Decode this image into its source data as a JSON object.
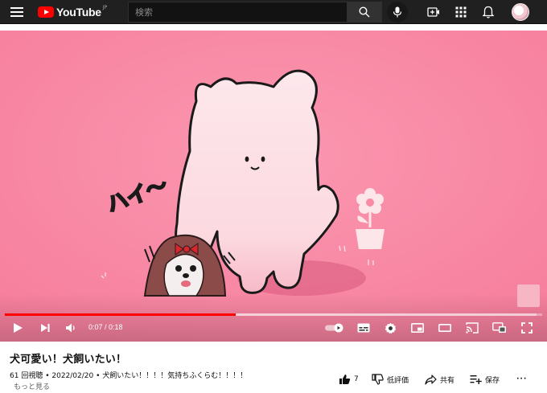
{
  "header": {
    "logo_text": "YouTube",
    "logo_region": "JP",
    "search_placeholder": "検索",
    "icons": [
      "menu-icon",
      "search-icon",
      "mic-icon",
      "create-icon",
      "apps-icon",
      "bell-icon"
    ]
  },
  "player": {
    "current_time": "0:07",
    "duration": "0:18",
    "progress_fraction": 0.43,
    "buffered_fraction": 0.99,
    "autoplay": true,
    "overlay_text": "ハイ〜",
    "icons": [
      "play-icon",
      "next-icon",
      "volume-icon",
      "autoplay-toggle",
      "subtitles-icon",
      "settings-icon",
      "miniplayer-icon",
      "theater-icon",
      "cast-icon",
      "remote-icon",
      "fullscreen-icon"
    ]
  },
  "video": {
    "title": "犬可愛い！犬飼いたい！",
    "views": "61 回視聴",
    "date": "2022/02/20",
    "description": "犬飼いたい！！！！気持ちふくらむ！！！！",
    "more_label": "もっと見る",
    "actions": {
      "likes": "7",
      "dislike_label": "低評価",
      "share_label": "共有",
      "save_label": "保存"
    }
  },
  "colors": {
    "header_bg": "#202020",
    "video_bg": "#f98ba6",
    "progress": "#ff0000",
    "bear": "#fde6ea"
  }
}
